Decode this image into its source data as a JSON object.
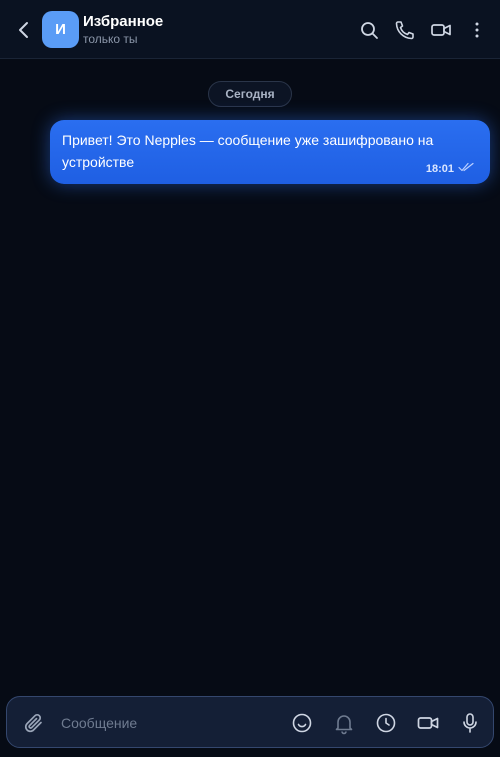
{
  "header": {
    "avatar_letter": "И",
    "title": "Избранное",
    "subtitle": "только ты",
    "icons": [
      "back-icon",
      "search-icon",
      "phone-icon",
      "video-camera-icon",
      "more-vertical-icon"
    ]
  },
  "chat": {
    "date_separator": "Сегодня",
    "messages": [
      {
        "text": "Привет! Это Nepples — сообщение уже зашифровано на устройстве",
        "time": "18:01",
        "status_icon": "double-check-icon",
        "outgoing": true
      }
    ]
  },
  "composer": {
    "placeholder": "Сообщение",
    "icons": [
      "paperclip-icon",
      "emoji-icon",
      "bell-icon",
      "clock-icon",
      "video-camera-icon",
      "microphone-icon"
    ]
  },
  "colors": {
    "background": "#060b15",
    "header_bg": "#0a1221",
    "accent": "#2a6ef0",
    "avatar": "#5a9cf6",
    "composer_border": "#34476e"
  }
}
